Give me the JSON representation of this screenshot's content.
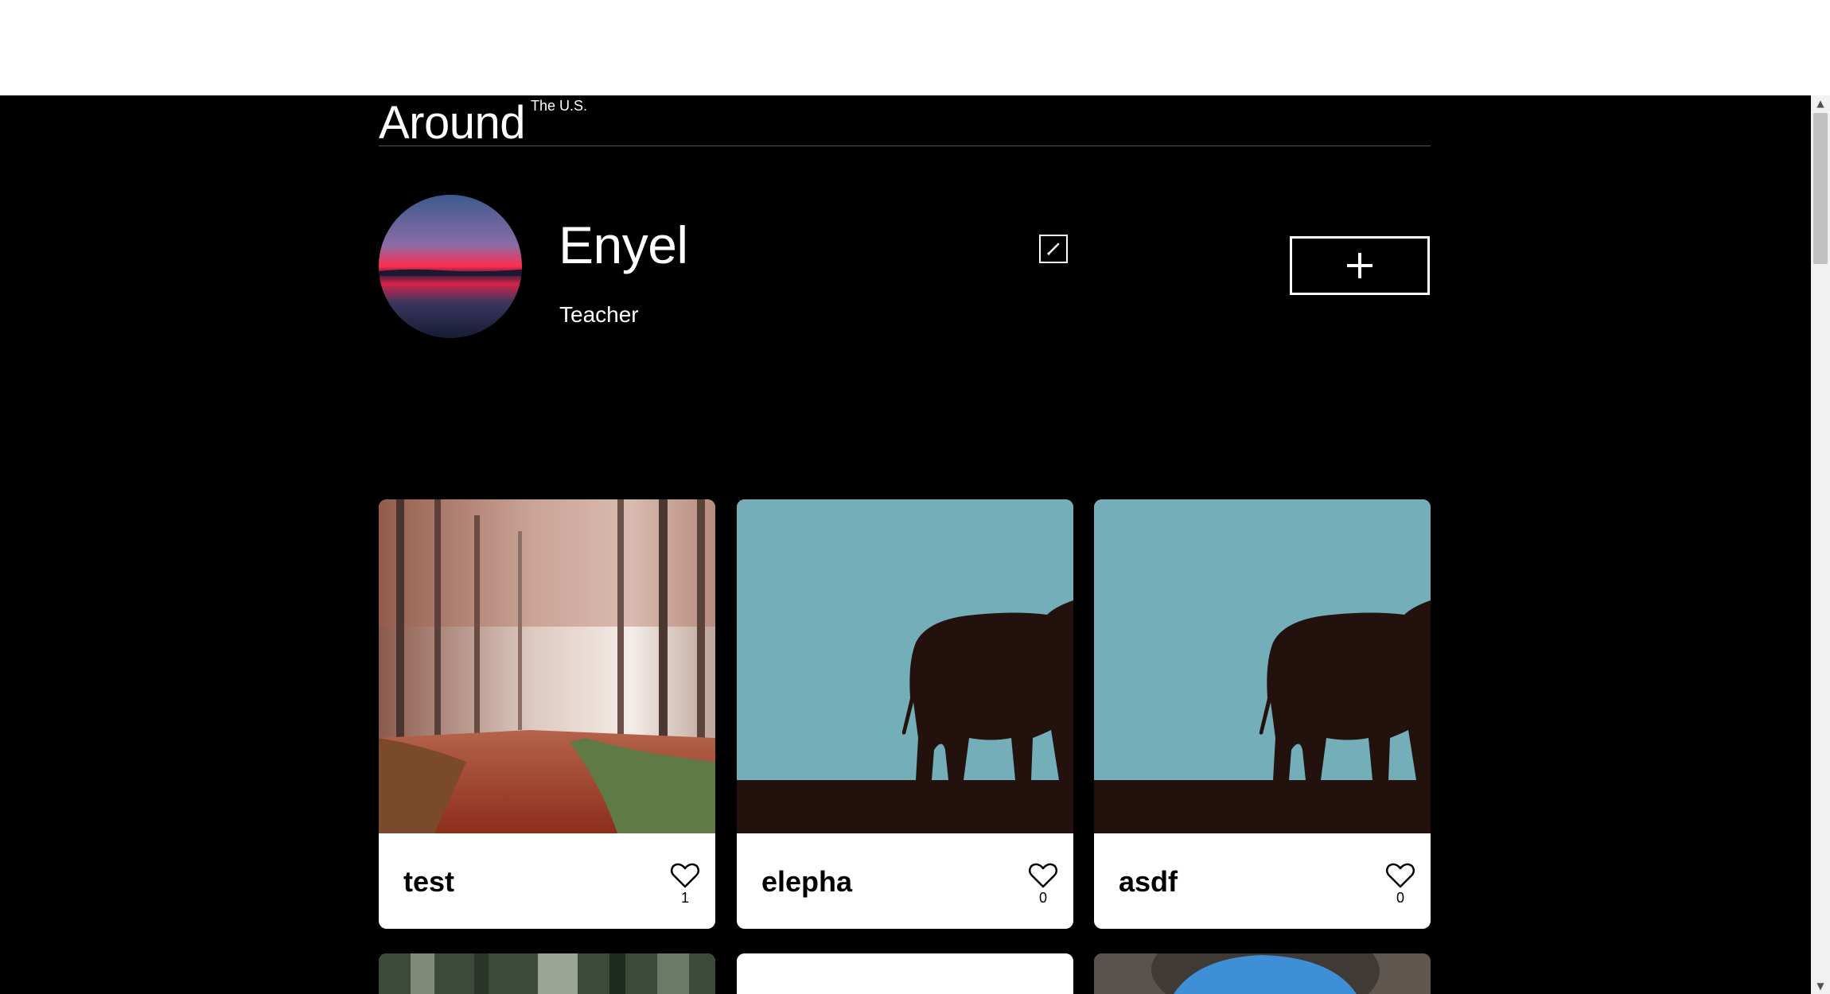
{
  "header": {
    "logo_main": "Around",
    "logo_sup": "The U.S."
  },
  "profile": {
    "name": "Enyel",
    "job": "Teacher",
    "edit_icon": "pencil-icon",
    "add_icon": "plus-icon"
  },
  "cards": [
    {
      "title": "test",
      "likes": "1",
      "image": "autumn-forest-path"
    },
    {
      "title": "elepha",
      "likes": "0",
      "image": "elephant-silhouette"
    },
    {
      "title": "asdf",
      "likes": "0",
      "image": "elephant-silhouette"
    },
    {
      "title": "",
      "likes": "",
      "image": "pine-forest"
    },
    {
      "title": "",
      "likes": "",
      "image": "blank"
    },
    {
      "title": "",
      "likes": "",
      "image": "cave-sky"
    }
  ],
  "colors": {
    "page_background": "#000000",
    "card_background": "#ffffff",
    "elephant_sky": "#74AEB9",
    "elephant_silhouette": "#22110C"
  }
}
